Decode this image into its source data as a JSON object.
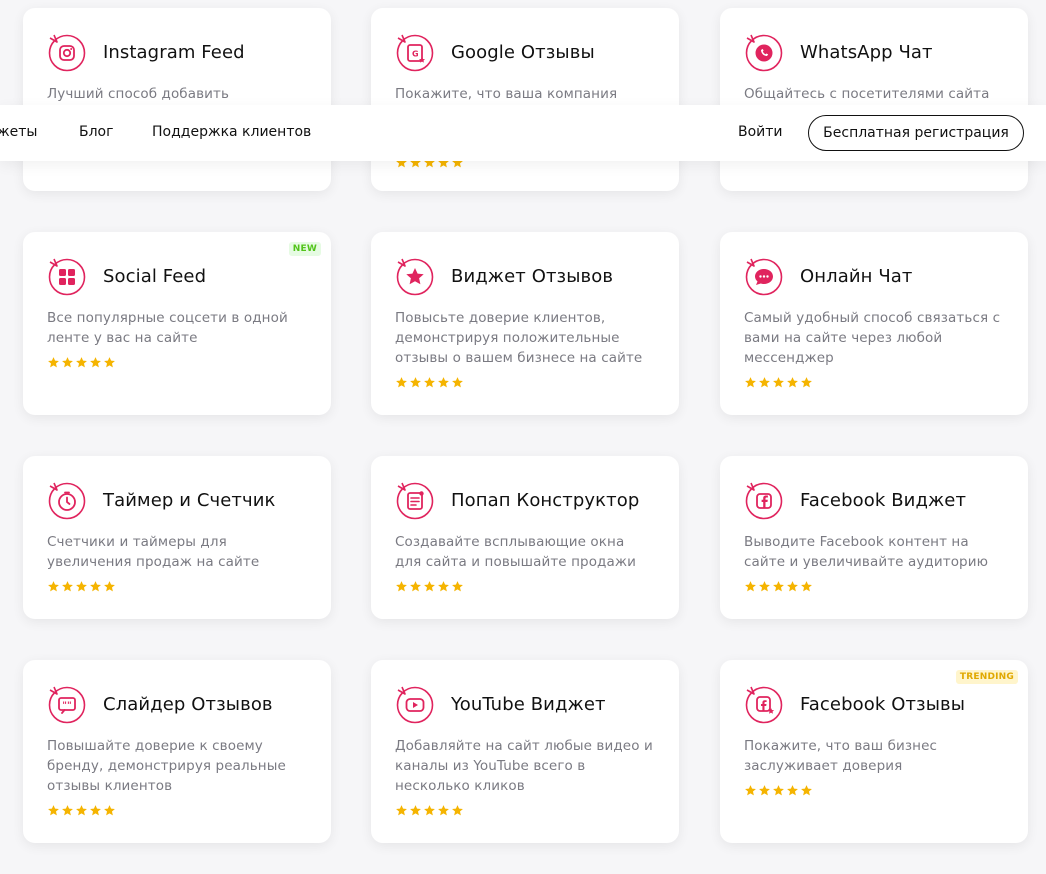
{
  "nav": {
    "widgets_label": "жеты",
    "blog_label": "Блог",
    "support_label": "Поддержка клиентов",
    "login_label": "Войти",
    "signup_label": "Бесплатная регистрация"
  },
  "colors": {
    "accent": "#e0245e",
    "star": "#f5b400"
  },
  "cards": [
    {
      "title": "Instagram Feed",
      "description": "Лучший способ добавить Инстаграм",
      "icon": "instagram-icon",
      "rating": 5
    },
    {
      "title": "Google Отзывы",
      "description": "Покажите, что ваша компания",
      "icon": "google-reviews-icon",
      "rating": 5
    },
    {
      "title": "WhatsApp Чат",
      "description": "Общайтесь с посетителями сайта",
      "icon": "whatsapp-icon",
      "rating": 5
    },
    {
      "title": "Social Feed",
      "description": "Все популярные соцсети в одной ленте у вас на сайте",
      "icon": "social-feed-icon",
      "badge": "NEW",
      "rating": 5
    },
    {
      "title": "Виджет Отзывов",
      "description": "Повысьте доверие клиентов, демонстрируя положительные отзывы о вашем бизнесе на сайте",
      "icon": "star-icon",
      "rating": 5
    },
    {
      "title": "Онлайн Чат",
      "description": "Самый удобный способ связаться с вами на сайте через любой мессенджер",
      "icon": "chat-icon",
      "rating": 5
    },
    {
      "title": "Таймер и Счетчик",
      "description": "Счетчики и таймеры для увеличения продаж на сайте",
      "icon": "timer-icon",
      "rating": 5
    },
    {
      "title": "Попап Конструктор",
      "description": "Создавайте всплывающие окна для сайта и повышайте продажи",
      "icon": "popup-icon",
      "rating": 5
    },
    {
      "title": "Facebook Виджет",
      "description": "Выводите Facebook контент на сайте и увеличивайте аудиторию",
      "icon": "facebook-icon",
      "rating": 5
    },
    {
      "title": "Слайдер Отзывов",
      "description": "Повышайте доверие к своему бренду, демонстрируя реальные отзывы клиентов",
      "icon": "quote-icon",
      "rating": 5
    },
    {
      "title": "YouTube Виджет",
      "description": "Добавляйте на сайт любые видео и каналы из YouTube всего в несколько кликов",
      "icon": "youtube-icon",
      "rating": 5
    },
    {
      "title": "Facebook Отзывы",
      "description": "Покажите, что ваш бизнес заслуживает доверия",
      "icon": "facebook-reviews-icon",
      "badge": "TRENDING",
      "rating": 5
    }
  ]
}
